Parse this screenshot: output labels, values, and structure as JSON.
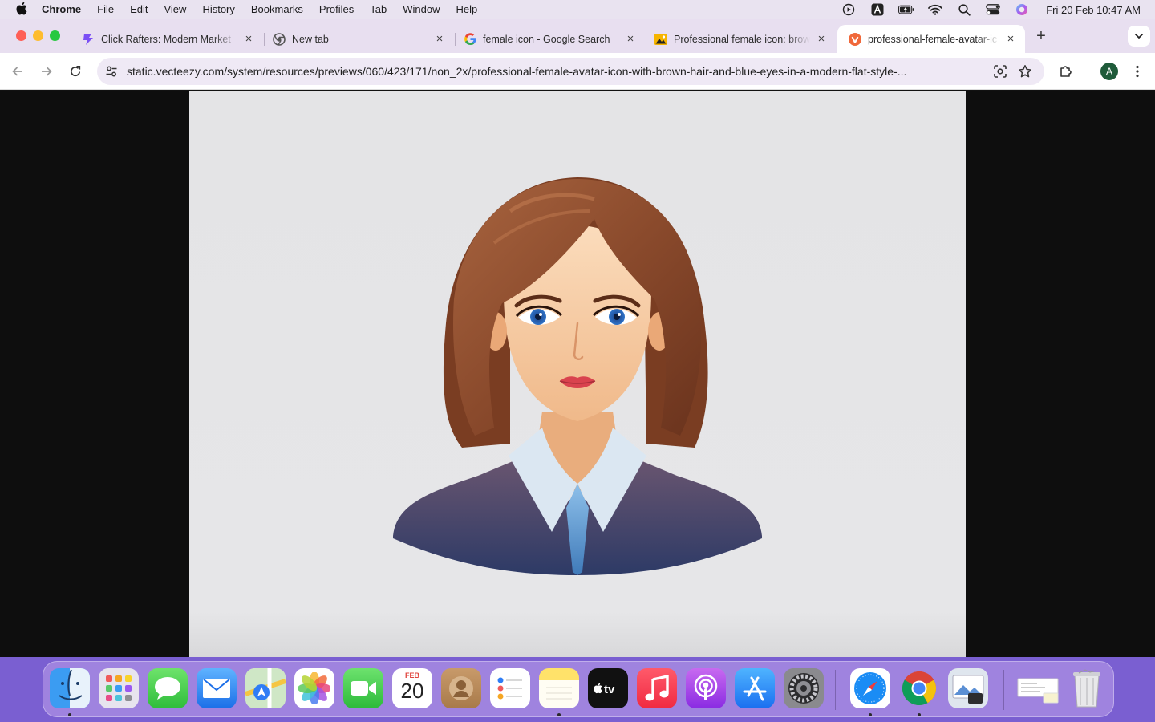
{
  "menubar": {
    "app_name": "Chrome",
    "items": [
      "File",
      "Edit",
      "View",
      "History",
      "Bookmarks",
      "Profiles",
      "Tab",
      "Window",
      "Help"
    ],
    "status_icons": [
      "screen-record-icon",
      "keyboard-input-a-icon",
      "battery-charging-icon",
      "wifi-icon",
      "spotlight-search-icon",
      "control-center-icon",
      "siri-icon"
    ],
    "clock": "Fri 20 Feb  10:47 AM"
  },
  "browser": {
    "tabs": [
      {
        "title": "Click Rafters: Modern Market",
        "icon": "clickrafters-icon"
      },
      {
        "title": "New tab",
        "icon": "chrome-icon"
      },
      {
        "title": "female icon - Google Search",
        "icon": "google-icon"
      },
      {
        "title": "Professional female icon: brow",
        "icon": "image-icon"
      },
      {
        "title": "professional-female-avatar-ic",
        "icon": "vecteezy-icon",
        "active": true
      }
    ],
    "url": "static.vecteezy.com/system/resources/previews/060/423/171/non_2x/professional-female-avatar-icon-with-brown-hair-and-blue-eyes-in-a-modern-flat-style-...",
    "profile_initial": "A"
  },
  "page": {
    "image_subject": "professional-female-avatar"
  },
  "dock": {
    "apps": [
      "Finder",
      "Launchpad",
      "Messages",
      "Mail",
      "Maps",
      "Photos",
      "FaceTime",
      "Calendar",
      "Contacts",
      "Reminders",
      "Notes",
      "TV",
      "Music",
      "Podcasts",
      "App Store",
      "System Settings",
      "Safari",
      "Chrome",
      "Preview",
      "Downloads",
      "Trash"
    ],
    "calendar_month": "FEB",
    "calendar_day": "20"
  }
}
